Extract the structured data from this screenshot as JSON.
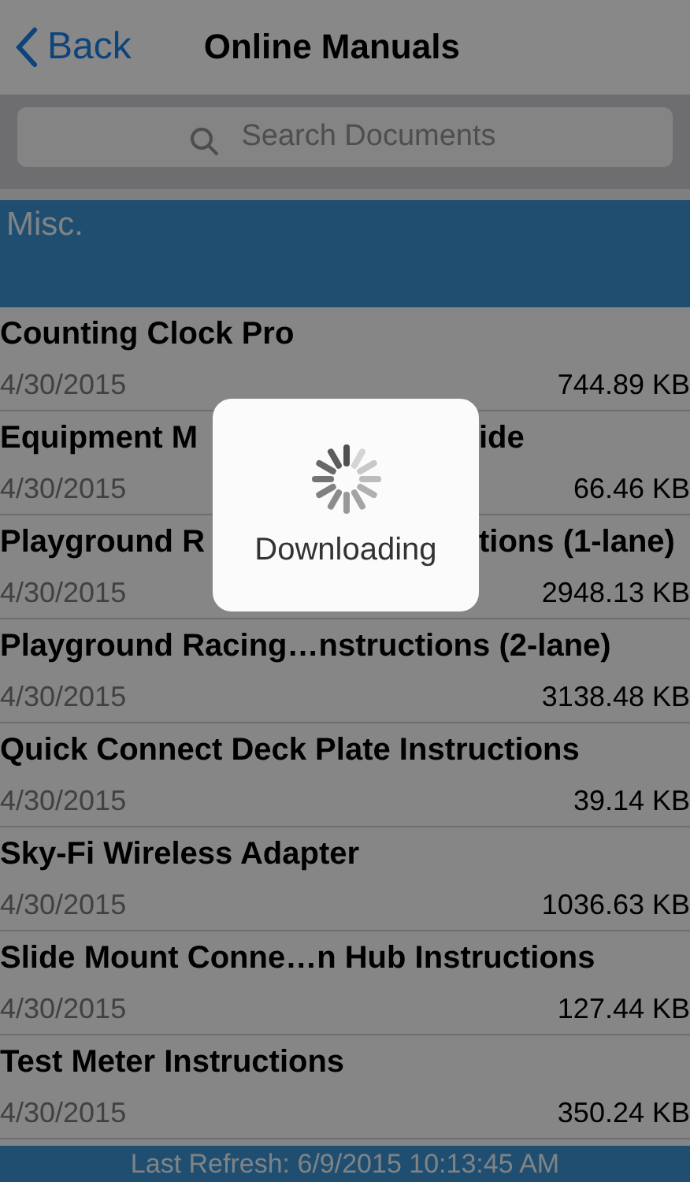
{
  "nav": {
    "back": "Back",
    "title": "Online Manuals"
  },
  "search": {
    "placeholder": "Search Documents"
  },
  "section": {
    "title": "Misc."
  },
  "rows": [
    {
      "title": "Counting Clock Pro",
      "date": "4/30/2015",
      "size": "744.89 KB"
    },
    {
      "title_left": "Equipment M",
      "title_right": "ide",
      "date": "4/30/2015",
      "size": "66.46 KB"
    },
    {
      "title_left": "Playground R",
      "title_right": "tions (1-lane)",
      "date": "4/30/2015",
      "size": "2948.13 KB"
    },
    {
      "title": "Playground Racing…nstructions (2-lane)",
      "date": "4/30/2015",
      "size": "3138.48 KB"
    },
    {
      "title": "Quick Connect Deck Plate Instructions",
      "date": "4/30/2015",
      "size": "39.14 KB"
    },
    {
      "title": "Sky-Fi Wireless Adapter",
      "date": "4/30/2015",
      "size": "1036.63 KB"
    },
    {
      "title": "Slide Mount Conne…n Hub Instructions",
      "date": "4/30/2015",
      "size": "127.44 KB"
    },
    {
      "title": "Test Meter Instructions",
      "date": "4/30/2015",
      "size": "350.24 KB"
    }
  ],
  "footer": {
    "text": "Last Refresh:  6/9/2015 10:13:45 AM"
  },
  "hud": {
    "label": "Downloading"
  }
}
